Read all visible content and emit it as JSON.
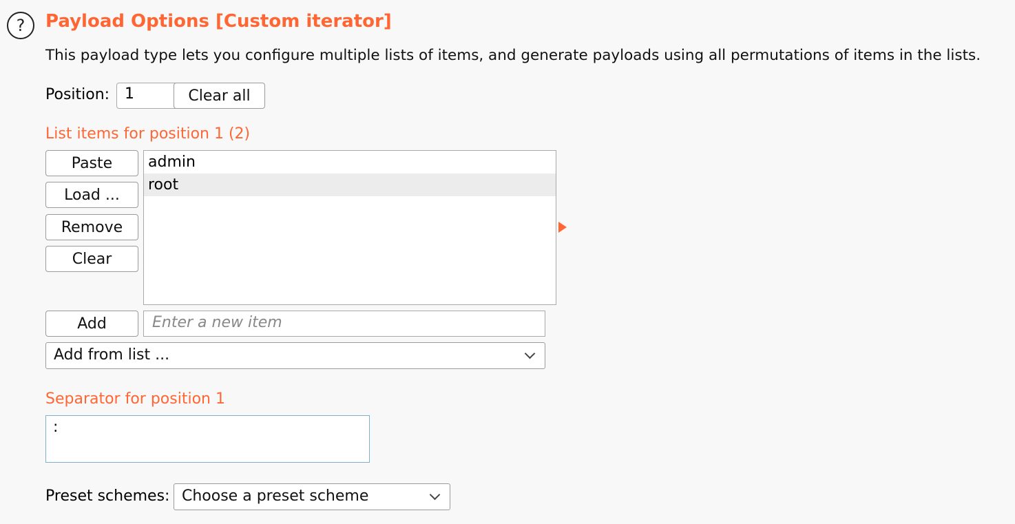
{
  "header": {
    "help_icon": "?",
    "title": "Payload Options [Custom iterator]",
    "description": "This payload type lets you configure multiple lists of items, and generate payloads using all permutations of items in the lists."
  },
  "position": {
    "label": "Position:",
    "value": "1",
    "clear_all_label": "Clear all"
  },
  "list": {
    "label": "List items for position 1 (2)",
    "buttons": {
      "paste": "Paste",
      "load": "Load ...",
      "remove": "Remove",
      "clear": "Clear"
    },
    "items": [
      "admin",
      "root"
    ],
    "selected_index": 1
  },
  "add": {
    "button_label": "Add",
    "placeholder": "Enter a new item",
    "add_from_list": "Add from list ..."
  },
  "separator": {
    "label": "Separator for position 1",
    "value": ":"
  },
  "preset": {
    "label": "Preset schemes:",
    "selected": "Choose a preset scheme"
  },
  "colors": {
    "accent": "#ff6633",
    "background": "#f8f8f8"
  }
}
